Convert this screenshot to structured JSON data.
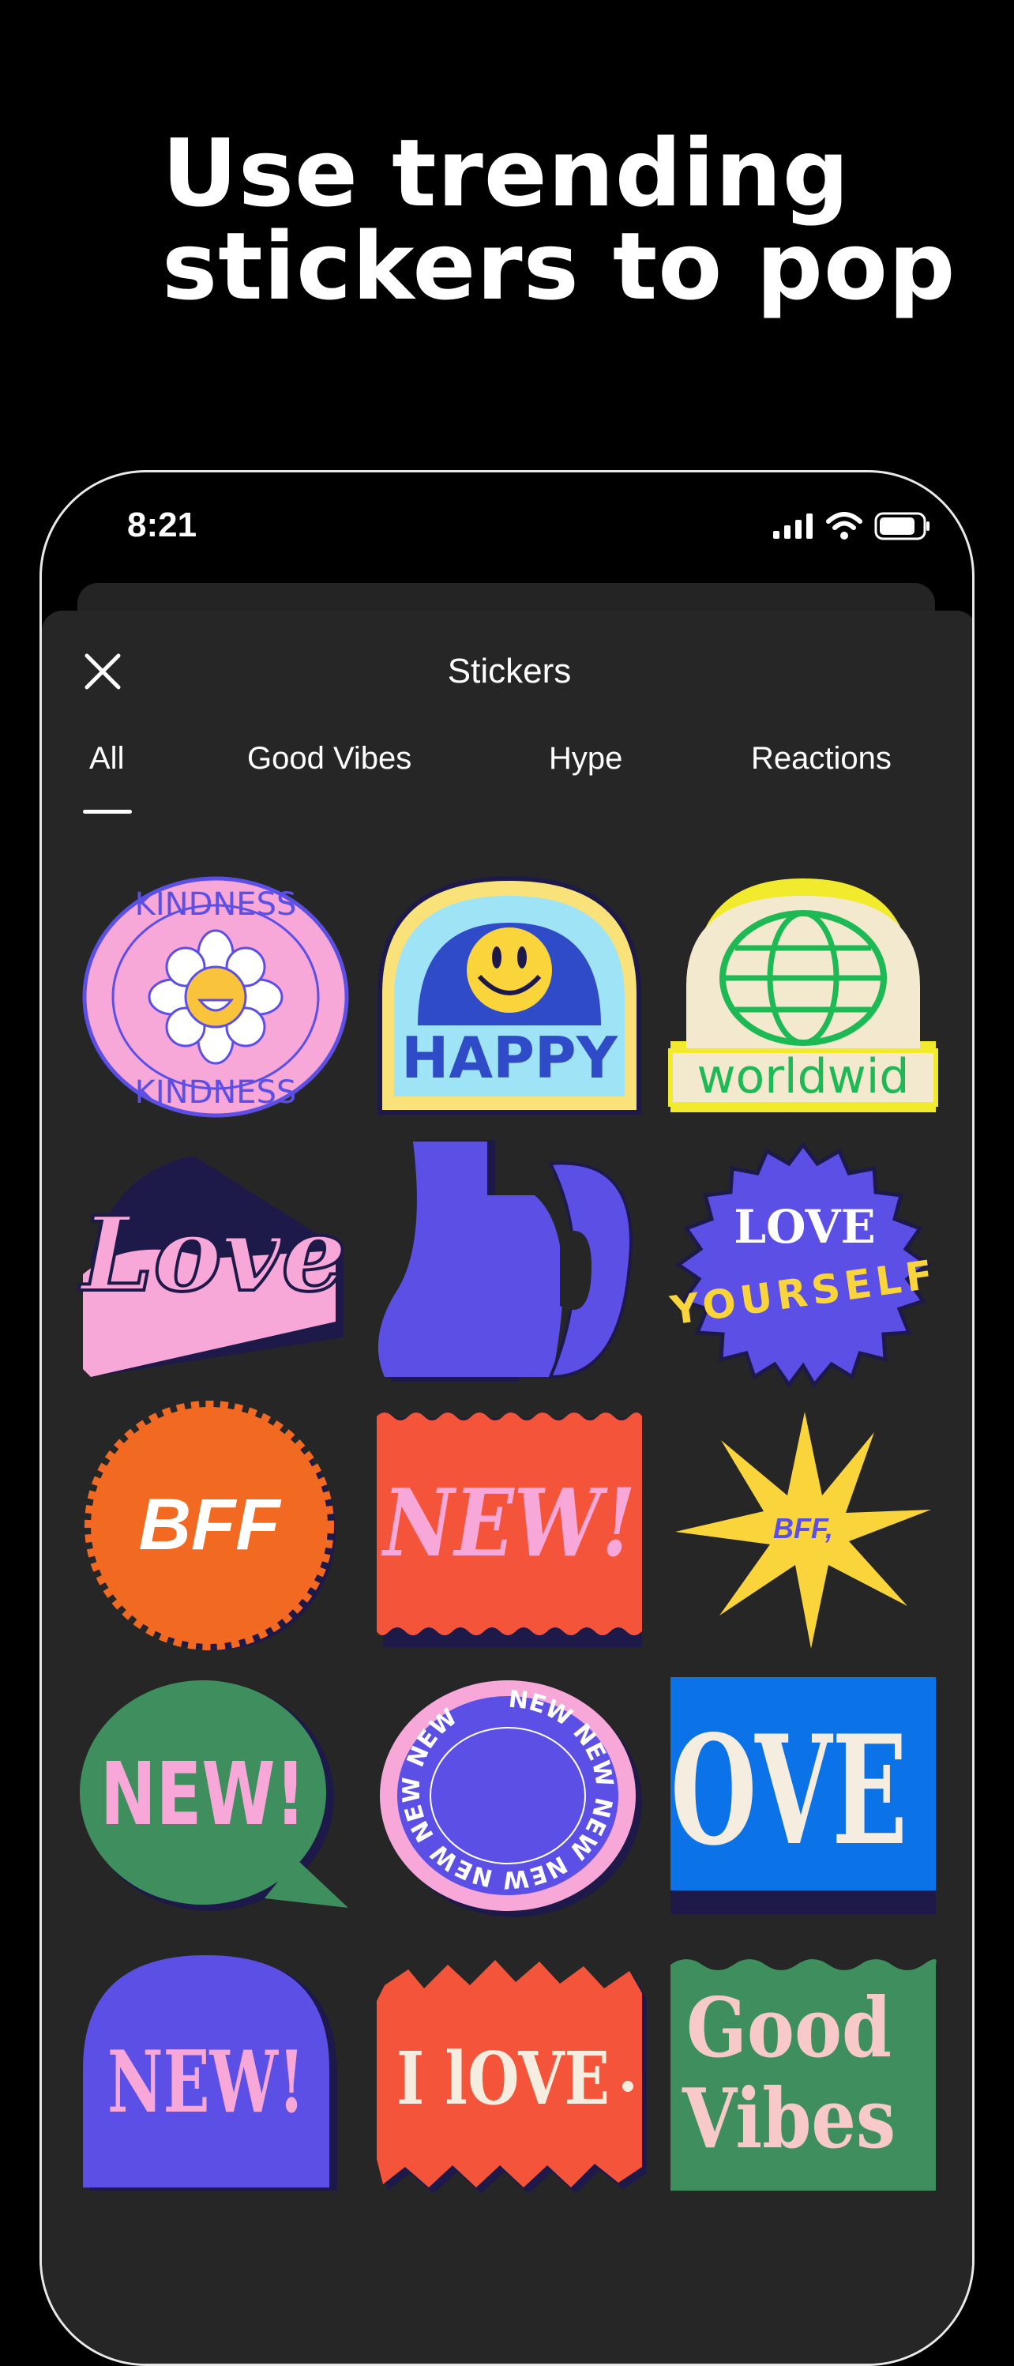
{
  "headline": {
    "line1": "Use trending",
    "line2": "stickers to pop"
  },
  "status": {
    "time": "8:21"
  },
  "sheet": {
    "title": "Stickers",
    "tabs": [
      {
        "label": "All",
        "selected": true
      },
      {
        "label": "Good Vibes",
        "selected": false
      },
      {
        "label": "Hype",
        "selected": false
      },
      {
        "label": "Reactions",
        "selected": false
      }
    ]
  },
  "stickers": {
    "kindness": "KINDNESS",
    "happy": "HAPPY",
    "worldwide": "worldwid",
    "love_script": "Love",
    "love_yourself_1": "LOVE",
    "love_yourself_2": "YOURSELF",
    "bff": "BFF",
    "new_1": "NEW!",
    "bff_star": "BFF,",
    "new_2": "NEW!",
    "new_circle": "NEW NEW NEW NEW NEW NEW NEW",
    "love_block": "OVE",
    "new_3": "NEW!",
    "i_love": "I lOVE",
    "good": "Good",
    "vibes": "Vibes"
  },
  "colors": {
    "background": "#000000",
    "sheet": "#262626",
    "pink": "#F7A8D8",
    "purple": "#5B4FE6",
    "orange": "#F26A21",
    "red": "#F4543A",
    "yellow": "#F9D43B",
    "green": "#3E8E5E",
    "blue": "#0B72E7"
  }
}
